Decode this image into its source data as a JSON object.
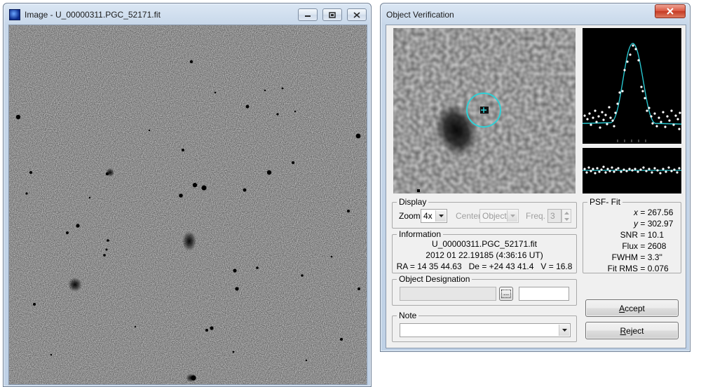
{
  "image_window": {
    "title": "Image - U_00000311.PGC_52171.fit"
  },
  "verify_window": {
    "title": "Object Verification",
    "display": {
      "legend": "Display",
      "zoom_label": "Zoom",
      "zoom_value": "4x",
      "center_label": "Center",
      "center_value": "Object",
      "freq_label": "Freq.",
      "freq_value": "3"
    },
    "information": {
      "legend": "Information",
      "filename": "U_00000311.PGC_52171.fit",
      "datetime": "2012 01 22.19185 (4:36:16 UT)",
      "coords": "RA = 14 35 44.63   De = +24 43 41.4   V = 16.8"
    },
    "designation": {
      "legend": "Object Designation",
      "browse_label": "..."
    },
    "note": {
      "legend": "Note"
    },
    "psf": {
      "legend": "PSF- Fit",
      "x_label": "x",
      "x": "267.56",
      "y_label": "y",
      "y": "302.97",
      "snr_label": "SNR",
      "snr": "10.1",
      "flux_label": "Flux",
      "flux": "2608",
      "fwhm_label": "FWHM",
      "fwhm": "3.3''",
      "rms_label": "Fit RMS",
      "rms": "0.076"
    },
    "buttons": {
      "accept_key": "A",
      "accept_rest": "ccept",
      "reject_key": "R",
      "reject_rest": "eject"
    }
  },
  "colors": {
    "fit_curve": "#27c7d0",
    "marker_circle": "#2fd0d6"
  }
}
